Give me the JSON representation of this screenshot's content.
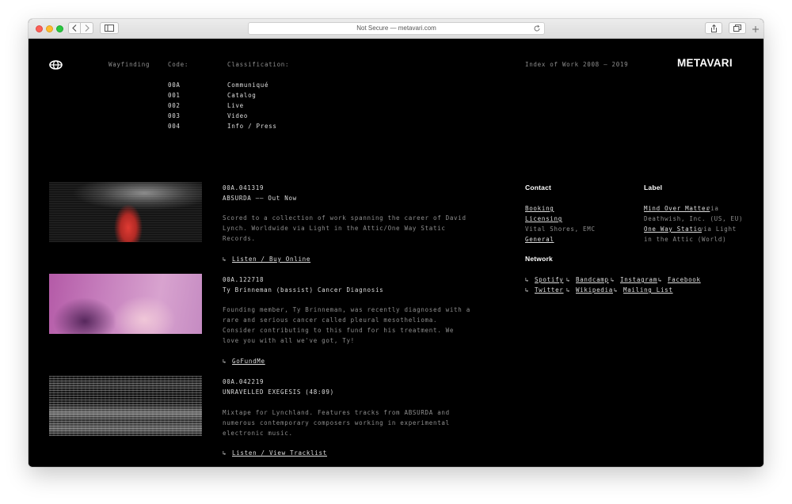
{
  "browser": {
    "url_text": "Not Secure — metavari.com",
    "nav": {
      "back_icon": "chevron-left-icon",
      "forward_icon": "chevron-right-icon"
    }
  },
  "header": {
    "logo": "METAVARI",
    "wayfinding": "Wayfinding",
    "code_label": "Code:",
    "classification_label": "Classification:",
    "index": "Index of Work 2008 – 2019",
    "menu": [
      {
        "code": "00A",
        "label": "Communiqué"
      },
      {
        "code": "001",
        "label": "Catalog"
      },
      {
        "code": "002",
        "label": "Live"
      },
      {
        "code": "003",
        "label": "Video"
      },
      {
        "code": "004",
        "label": "Info / Press"
      }
    ]
  },
  "posts": [
    {
      "id": "00A.041319",
      "title": "ABSURDA —— Out Now",
      "body": [
        "Scored to a collection of work spanning the career of David",
        "Lynch. Worldwide via Light in the Attic/One Way Static",
        "Records."
      ],
      "link": "Listen / Buy Online"
    },
    {
      "id": "00A.122718",
      "title": "Ty Brinneman (bassist) Cancer Diagnosis",
      "body": [
        "Founding member, Ty Brinneman, was recently diagnosed with a",
        "rare and serious cancer called pleural mesothelioma.",
        "Consider contributing to this fund for his treatment. We",
        "love you with all we've got, Ty!"
      ],
      "link": "GoFundMe"
    },
    {
      "id": "00A.042219",
      "title": "UNRAVELLED EXEGESIS (48:09)",
      "body": [
        "Mixtape for Lynchland. Features tracks from ABSURDA and",
        "numerous contemporary composers working in experimental",
        "electronic music."
      ],
      "link": "Listen / View Tracklist"
    }
  ],
  "contact": {
    "heading": "Contact",
    "booking": "Booking",
    "licensing": "Licensing",
    "licensing_note": "Vital Shores, EMC",
    "general": "General"
  },
  "label": {
    "heading": "Label",
    "mom_link": "Mind Over Matter",
    "mom_via": "via",
    "mom_note": "Deathwish, Inc. (US, EU)",
    "ows_link": "One Way Static",
    "ows_via": "via Light",
    "ows_note": "in the Attic (World)"
  },
  "network": {
    "heading": "Network",
    "links": [
      "Spotify",
      "Bandcamp",
      "Instagram",
      "Facebook",
      "Twitter",
      "Wikipedia",
      "Mailing List"
    ]
  },
  "arrow": "↳"
}
